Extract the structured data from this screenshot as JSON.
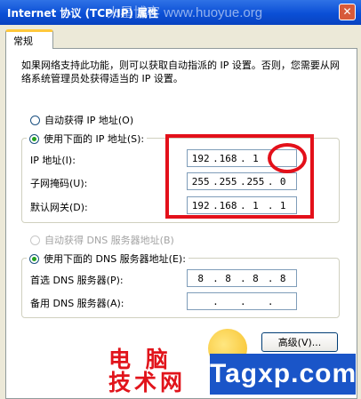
{
  "window": {
    "title": "Internet 协议 (TCP/IP) 属性",
    "watermark_url": "火星博客 www.huoyue.org"
  },
  "tabs": [
    {
      "label": "常规"
    }
  ],
  "description": "如果网络支持此功能，则可以获取自动指派的 IP 设置。否则，您需要从网络系统管理员处获得适当的 IP 设置。",
  "ip_section": {
    "auto_label": "自动获得 IP 地址(O)",
    "manual_label": "使用下面的 IP 地址(S):",
    "selected": "manual",
    "fields": [
      {
        "label": "IP 地址(I):",
        "octets": [
          "192",
          "168",
          "1",
          ""
        ]
      },
      {
        "label": "子网掩码(U):",
        "octets": [
          "255",
          "255",
          "255",
          "0"
        ]
      },
      {
        "label": "默认网关(D):",
        "octets": [
          "192",
          "168",
          "1",
          "1"
        ]
      }
    ]
  },
  "dns_section": {
    "auto_label": "自动获得 DNS 服务器地址(B)",
    "manual_label": "使用下面的 DNS 服务器地址(E):",
    "selected": "manual",
    "fields": [
      {
        "label": "首选 DNS 服务器(P):",
        "octets": [
          "8",
          "8",
          "8",
          "8"
        ]
      },
      {
        "label": "备用 DNS 服务器(A):",
        "octets": [
          "",
          "",
          "",
          ""
        ]
      }
    ]
  },
  "buttons": {
    "advanced": "高级(V)..."
  },
  "watermark": {
    "cn_line1": "电 脑",
    "cn_line2": "技术网",
    "site": "Tagxp.com"
  },
  "colors": {
    "title_bar": "#0b4fd6",
    "annotation_red": "#e3101a",
    "radio_selected": "#21a121",
    "banner_blue": "#1a55c8"
  }
}
